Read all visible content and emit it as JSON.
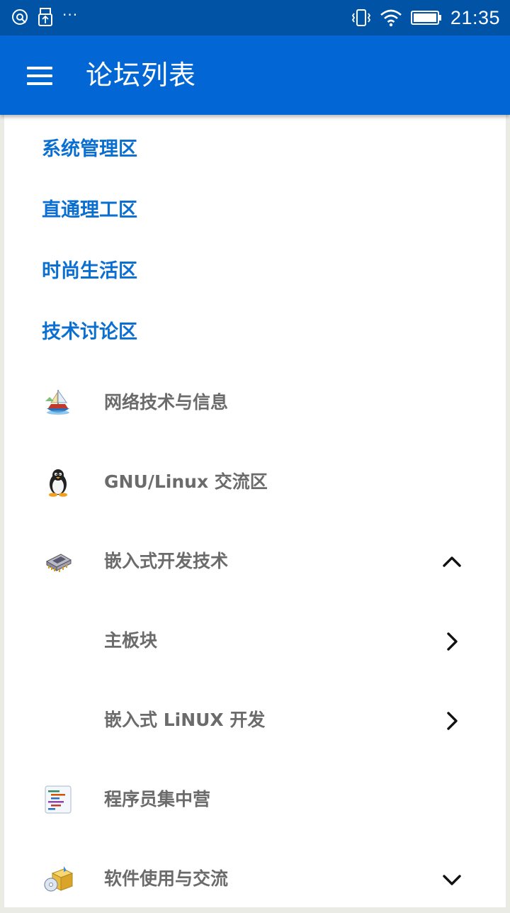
{
  "status_bar": {
    "time": "21:35",
    "left_icons": [
      "disc-icon",
      "usb-icon",
      "more-dots-icon"
    ],
    "more_dots": "···",
    "right_icons": [
      "vibrate-icon",
      "wifi-icon",
      "battery-icon"
    ],
    "background": "#0153a6"
  },
  "app_bar": {
    "title": "论坛列表",
    "menu_icon": "hamburger-menu-icon",
    "background": "#0267d4"
  },
  "categories": [
    {
      "label": "系统管理区"
    },
    {
      "label": "直通理工区"
    },
    {
      "label": "时尚生活区"
    },
    {
      "label": "技术讨论区"
    }
  ],
  "forums": [
    {
      "label": "网络技术与信息",
      "icon": "network-ship-icon",
      "chevron": null
    },
    {
      "label": "GNU/Linux 交流区",
      "icon": "linux-penguin-icon",
      "chevron": null
    },
    {
      "label": "嵌入式开发技术",
      "icon": "chip-icon",
      "chevron": "up"
    },
    {
      "label": "主板块",
      "icon": null,
      "chevron": "right"
    },
    {
      "label": "嵌入式 LiNUX 开发",
      "icon": null,
      "chevron": "right"
    },
    {
      "label": "程序员集中营",
      "icon": "code-editor-icon",
      "chevron": null
    },
    {
      "label": "软件使用与交流",
      "icon": "software-box-icon",
      "chevron": "down"
    }
  ],
  "colors": {
    "category_text": "#0a6fd0",
    "forum_text": "#6b6b6b",
    "page_background": "#ebebe6"
  }
}
